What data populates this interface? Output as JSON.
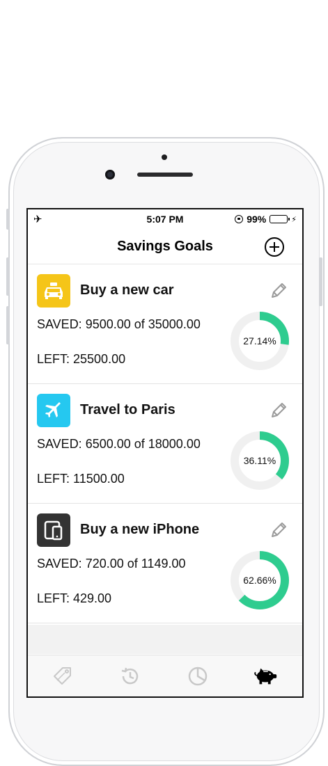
{
  "status": {
    "time": "5:07 PM",
    "battery_text": "99%",
    "battery_level": 0.99,
    "airplane_icon": "airplane-icon"
  },
  "nav": {
    "title": "Savings Goals",
    "add_icon": "plus-circle-icon"
  },
  "goals": [
    {
      "title": "Buy a new car",
      "saved": "SAVED: 9500.00 of 35000.00",
      "left": "LEFT: 25500.00",
      "percent_text": "27.14%",
      "progress": 0.2714,
      "icon": "taxi-icon",
      "icon_bg": "#f5c518"
    },
    {
      "title": "Travel to Paris",
      "saved": "SAVED: 6500.00 of 18000.00",
      "left": "LEFT: 11500.00",
      "percent_text": "36.11%",
      "progress": 0.3611,
      "icon": "airplane-icon",
      "icon_bg": "#25c8f0"
    },
    {
      "title": "Buy a new iPhone",
      "saved": "SAVED: 720.00 of 1149.00",
      "left": "LEFT: 429.00",
      "percent_text": "62.66%",
      "progress": 0.6266,
      "icon": "devices-icon",
      "icon_bg": "#333333"
    }
  ],
  "tabs": [
    {
      "icon": "tag-icon",
      "active": false
    },
    {
      "icon": "history-icon",
      "active": false
    },
    {
      "icon": "pie-chart-icon",
      "active": false
    },
    {
      "icon": "piggy-bank-icon",
      "active": true
    }
  ],
  "colors": {
    "progress": "#2ecc8f",
    "track": "#f0f0f0",
    "inactive_icon": "#c8c8c8",
    "active_icon": "#000000",
    "edit_icon": "#9a9a9a"
  }
}
